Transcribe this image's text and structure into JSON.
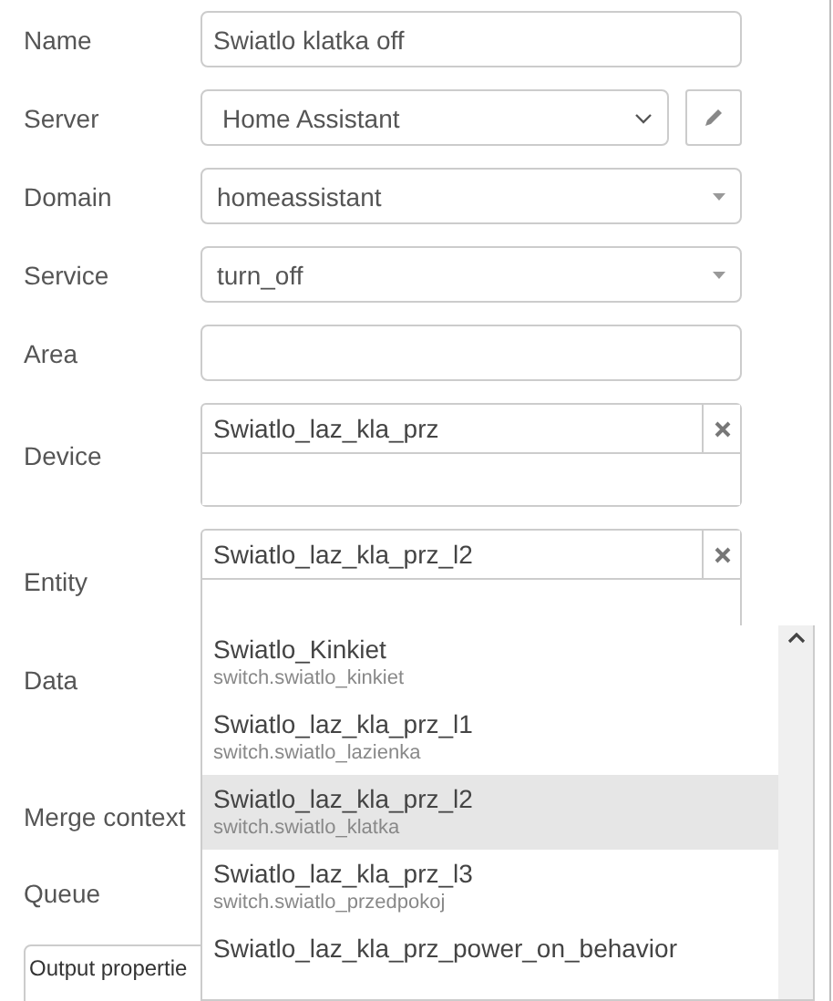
{
  "fields": [
    {
      "kind": "text",
      "label": "Name",
      "value": "Swiatlo klatka off"
    },
    {
      "kind": "server",
      "label": "Server",
      "value": "Home Assistant"
    },
    {
      "kind": "dropdown",
      "label": "Domain",
      "value": "homeassistant"
    },
    {
      "kind": "dropdown",
      "label": "Service",
      "value": "turn_off"
    },
    {
      "kind": "text",
      "label": "Area"
    },
    {
      "kind": "multiselect",
      "label": "Device",
      "value": "Swiatlo_laz_kla_prz"
    },
    {
      "kind": "multiselect",
      "label": "Entity",
      "value": "Swiatlo_laz_kla_prz_l2"
    },
    {
      "kind": "editor",
      "label": "Data"
    },
    {
      "kind": "blank",
      "label": "Merge context"
    },
    {
      "kind": "blank",
      "label": "Queue"
    }
  ],
  "output_properties": {
    "title": "Output propertie"
  },
  "entity_menu": [
    {
      "name": "Swiatlo_Kinkiet",
      "entity_id": "switch.swiatlo_kinkiet",
      "selected": false
    },
    {
      "name": "Swiatlo_laz_kla_prz_l1",
      "entity_id": "switch.swiatlo_lazienka",
      "selected": false
    },
    {
      "name": "Swiatlo_laz_kla_prz_l2",
      "entity_id": "switch.swiatlo_klatka",
      "selected": true
    },
    {
      "name": "Swiatlo_laz_kla_prz_l3",
      "entity_id": "switch.swiatlo_przedpokoj",
      "selected": false
    },
    {
      "name": "Swiatlo_laz_kla_prz_power_on_behavior"
    }
  ]
}
